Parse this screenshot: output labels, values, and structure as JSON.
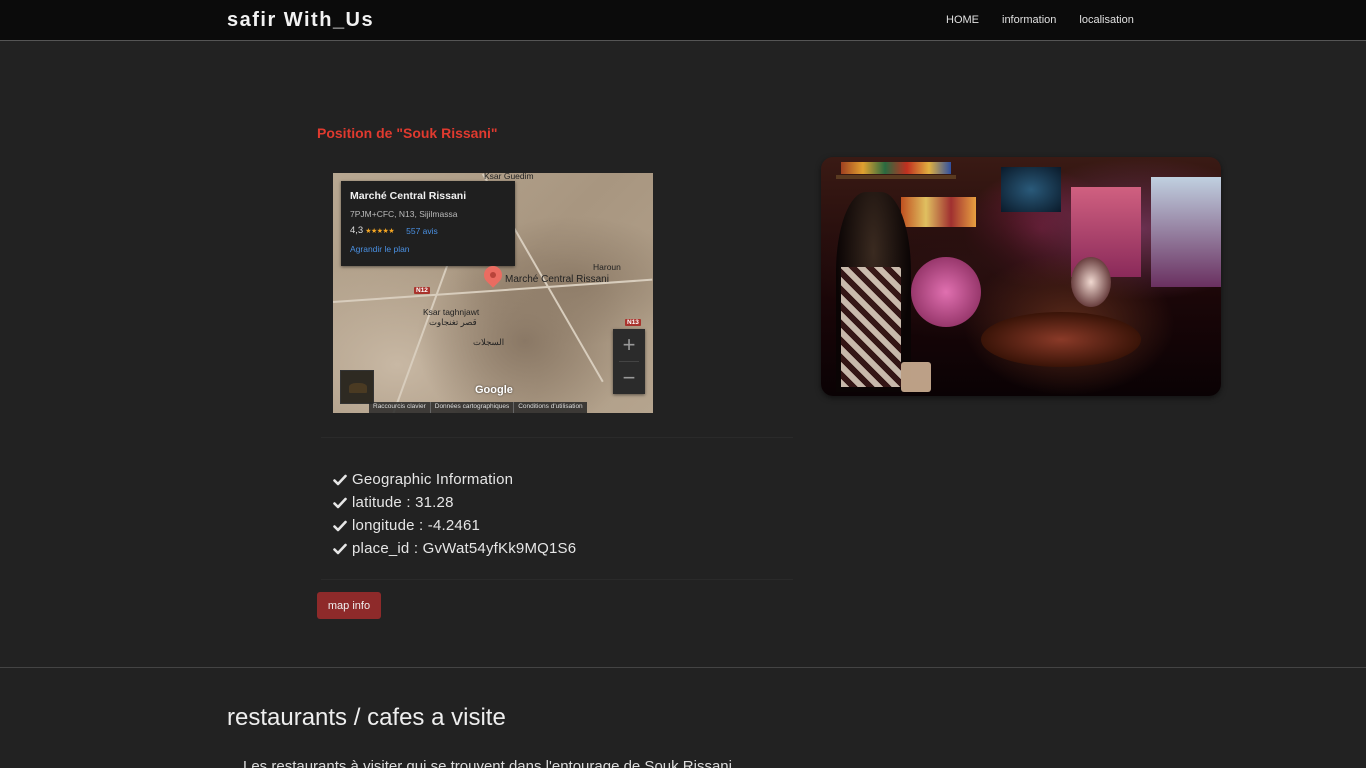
{
  "nav": {
    "brand": "safir With_Us",
    "links": [
      "HOME",
      "information",
      "localisation"
    ]
  },
  "position": {
    "title": "Position de \"Souk Rissani\""
  },
  "map": {
    "card": {
      "name": "Marché Central Rissani",
      "address": "7PJM+CFC, N13, Sijilmassa",
      "rating": "4,3",
      "stars": "★★★★★",
      "reviews": "557 avis",
      "enlarge": "Agrandir le plan"
    },
    "labels": {
      "ksar_guedim": "Ksar Guedim",
      "haroun": "Haroun",
      "marche": "Marché Central Rissani",
      "ksar_taghnjawt": "Ksar taghnjawt",
      "ksar_arabic": "قصر تغنجاوت",
      "sijilmassa_arabic": "السجلات",
      "n12": "N12",
      "n13": "N13",
      "google": "Google"
    },
    "zoom": {
      "in": "+",
      "out": "−"
    },
    "attribution": [
      "Raccourcis clavier",
      "Données cartographiques",
      "Conditions d'utilisation"
    ]
  },
  "geo": {
    "items": [
      "Geographic Information",
      "latitude : 31.28",
      "longitude : -4.2461",
      "place_id : GvWat54yfKk9MQ1S6"
    ]
  },
  "buttons": {
    "map_info": "map info"
  },
  "restaurants": {
    "title": "restaurants / cafes a visite",
    "text": "Les restaurants à visiter qui se trouvent dans l'entourage de Souk Rissani"
  }
}
